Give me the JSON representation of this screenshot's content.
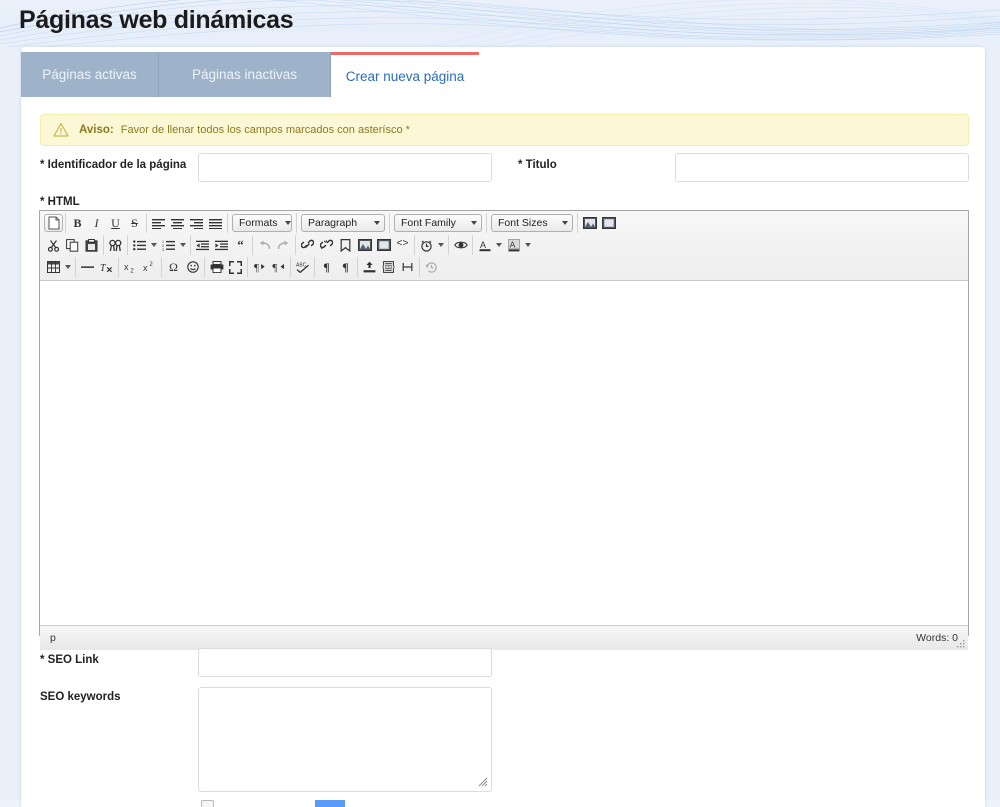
{
  "header": {
    "title": "Páginas web dinámicas",
    "accent_color": "#ec6a6a",
    "band_color": "#e9f0fb"
  },
  "tabs": [
    {
      "id": "paginas-activas",
      "label": "Páginas activas",
      "active": false
    },
    {
      "id": "paginas-inactivas",
      "label": "Páginas inactivas",
      "active": false
    },
    {
      "id": "crear-nueva",
      "label": "Crear nueva página",
      "active": true
    }
  ],
  "alert": {
    "icon": "warning-triangle-icon",
    "title": "Aviso:",
    "message": "Favor de llenar todos los campos marcados con asterísco *",
    "background": "#fcf8d5",
    "text_color": "#8a7a22"
  },
  "form": {
    "identificador": {
      "label": "* Identificador de la página",
      "value": "",
      "placeholder": ""
    },
    "titulo": {
      "label": "* Titulo",
      "value": "",
      "placeholder": ""
    },
    "html": {
      "label": "* HTML"
    },
    "seo_link": {
      "label": "* SEO Link",
      "value": "",
      "placeholder": ""
    },
    "seo_keywords": {
      "label": "SEO keywords",
      "value": "",
      "placeholder": ""
    }
  },
  "editor": {
    "content": "",
    "status_path": "p",
    "word_count": "Words: 0",
    "toolbar_rows": [
      {
        "groups": [
          {
            "buttons": [
              {
                "name": "new-document-icon",
                "framed": true
              }
            ]
          },
          {
            "buttons": [
              {
                "name": "bold-icon"
              },
              {
                "name": "italic-icon"
              },
              {
                "name": "underline-icon"
              },
              {
                "name": "strikethrough-icon"
              }
            ]
          },
          {
            "buttons": [
              {
                "name": "align-left-icon"
              },
              {
                "name": "align-center-icon"
              },
              {
                "name": "align-right-icon"
              },
              {
                "name": "align-justify-icon"
              }
            ]
          },
          {
            "selects": [
              {
                "name": "formats-select",
                "label": "Formats",
                "value": "Formats",
                "width": 56
              }
            ]
          },
          {
            "selects": [
              {
                "name": "block-format-select",
                "label": "Paragraph",
                "value": "Paragraph",
                "width": 76
              }
            ]
          },
          {
            "selects": [
              {
                "name": "font-family-select",
                "label": "Font Family",
                "value": "Font Family",
                "width": 82
              }
            ]
          },
          {
            "selects": [
              {
                "name": "font-sizes-select",
                "label": "Font Sizes",
                "value": "Font Sizes",
                "width": 76
              }
            ]
          },
          {
            "buttons": [
              {
                "name": "insert-image-icon"
              },
              {
                "name": "insert-media-icon"
              }
            ]
          }
        ]
      },
      {
        "groups": [
          {
            "buttons": [
              {
                "name": "cut-icon"
              },
              {
                "name": "copy-icon"
              },
              {
                "name": "paste-icon"
              }
            ]
          },
          {
            "buttons": [
              {
                "name": "search-replace-icon"
              }
            ]
          },
          {
            "buttons": [
              {
                "name": "bullet-list-icon",
                "caret": true
              },
              {
                "name": "numbered-list-icon",
                "caret": true
              }
            ]
          },
          {
            "buttons": [
              {
                "name": "outdent-icon"
              },
              {
                "name": "indent-icon"
              },
              {
                "name": "blockquote-icon"
              }
            ]
          },
          {
            "buttons": [
              {
                "name": "undo-icon",
                "disabled": true
              },
              {
                "name": "redo-icon",
                "disabled": true
              }
            ]
          },
          {
            "buttons": [
              {
                "name": "insert-link-icon"
              },
              {
                "name": "unlink-icon"
              },
              {
                "name": "anchor-icon"
              },
              {
                "name": "image-icon"
              },
              {
                "name": "media-icon"
              },
              {
                "name": "source-code-icon"
              }
            ]
          },
          {
            "buttons": [
              {
                "name": "insert-datetime-icon",
                "caret": true
              }
            ]
          },
          {
            "buttons": [
              {
                "name": "preview-icon"
              }
            ]
          },
          {
            "buttons": [
              {
                "name": "text-color-icon",
                "caret": true
              },
              {
                "name": "background-color-icon",
                "caret": true
              }
            ]
          }
        ]
      },
      {
        "groups": [
          {
            "buttons": [
              {
                "name": "insert-table-icon",
                "caret": true
              }
            ]
          },
          {
            "buttons": [
              {
                "name": "horizontal-rule-icon"
              },
              {
                "name": "remove-format-icon"
              }
            ]
          },
          {
            "buttons": [
              {
                "name": "subscript-icon"
              },
              {
                "name": "superscript-icon"
              }
            ]
          },
          {
            "buttons": [
              {
                "name": "special-character-icon"
              },
              {
                "name": "emoticon-icon"
              }
            ]
          },
          {
            "buttons": [
              {
                "name": "print-icon"
              },
              {
                "name": "fullscreen-icon"
              }
            ]
          },
          {
            "buttons": [
              {
                "name": "ltr-icon"
              },
              {
                "name": "rtl-icon"
              }
            ]
          },
          {
            "buttons": [
              {
                "name": "spellcheck-icon"
              }
            ]
          },
          {
            "buttons": [
              {
                "name": "show-blocks-icon"
              },
              {
                "name": "show-invisibles-icon"
              }
            ]
          },
          {
            "buttons": [
              {
                "name": "template-icon"
              },
              {
                "name": "page-break-icon"
              },
              {
                "name": "nonbreaking-icon"
              }
            ]
          },
          {
            "buttons": [
              {
                "name": "restore-draft-icon",
                "disabled": true
              }
            ]
          }
        ]
      }
    ]
  }
}
